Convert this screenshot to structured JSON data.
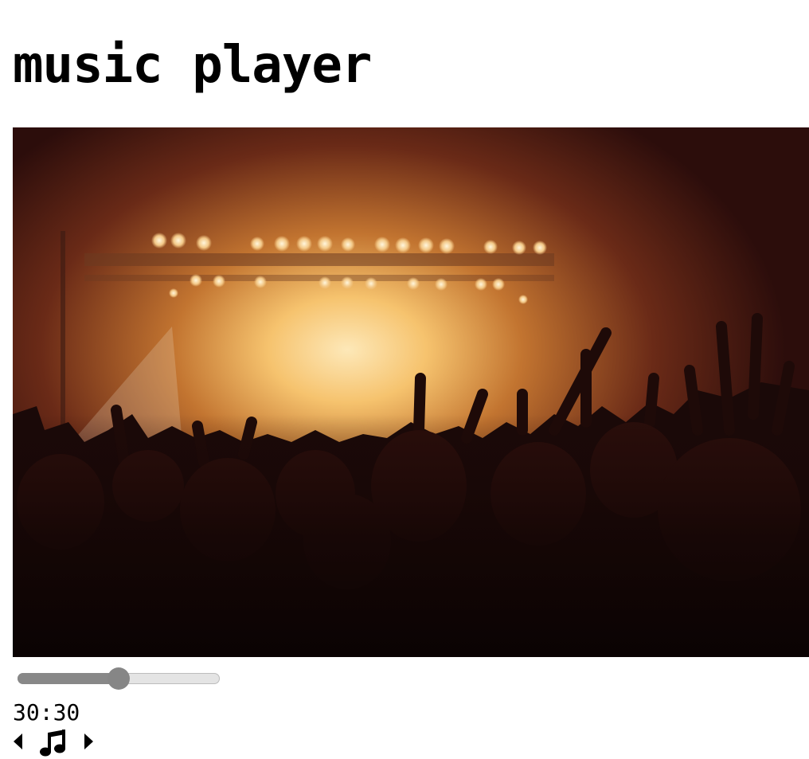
{
  "page": {
    "title": "music player"
  },
  "cover": {
    "icon": "concert-crowd-image"
  },
  "progress": {
    "value": 0.5,
    "fill_color": "#888888",
    "track_color": "#e4e4e4",
    "thumb_color": "#868686"
  },
  "time": {
    "display": "30:30"
  },
  "controls": {
    "prev_icon": "caret-left-icon",
    "play_icon": "music-note-icon",
    "next_icon": "caret-right-icon"
  }
}
